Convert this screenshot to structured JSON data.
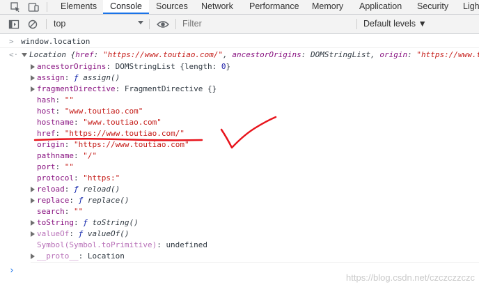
{
  "tabs": [
    {
      "label": "Elements",
      "active": false
    },
    {
      "label": "Console",
      "active": true
    },
    {
      "label": "Sources",
      "active": false
    },
    {
      "label": "Network",
      "active": false
    },
    {
      "label": "Performance",
      "active": false
    },
    {
      "label": "Memory",
      "active": false
    },
    {
      "label": "Application",
      "active": false
    },
    {
      "label": "Security",
      "active": false
    },
    {
      "label": "Ligh",
      "active": false
    }
  ],
  "toolbar": {
    "context": "top",
    "filter_placeholder": "Filter",
    "levels_label": "Default levels ▼"
  },
  "console": {
    "input_command": "window.location",
    "summary": {
      "type": "Location",
      "brace_open": " {",
      "href_key": "href",
      "href_val": "\"https://www.toutiao.com/\"",
      "ancestor_key": "ancestorOrigins",
      "ancestor_val": "DOMStringList",
      "origin_key": "origin",
      "origin_val": "\"https://www.t"
    },
    "props": {
      "ancestorOrigins": {
        "key": "ancestorOrigins",
        "type": "DOMStringList",
        "brace": "{length: ",
        "len": "0",
        "close": "}"
      },
      "assign": {
        "key": "assign",
        "fn": "ƒ",
        "name": "assign()"
      },
      "fragmentDirective": {
        "key": "fragmentDirective",
        "val": "FragmentDirective {}"
      },
      "hash": {
        "key": "hash",
        "val": "\"\""
      },
      "host": {
        "key": "host",
        "val": "\"www.toutiao.com\""
      },
      "hostname": {
        "key": "hostname",
        "val": "\"www.toutiao.com\""
      },
      "href": {
        "key": "href",
        "val": "\"https://www.toutiao.com/\""
      },
      "origin": {
        "key": "origin",
        "val": "\"https://www.toutiao.com\""
      },
      "pathname": {
        "key": "pathname",
        "val": "\"/\""
      },
      "port": {
        "key": "port",
        "val": "\"\""
      },
      "protocol": {
        "key": "protocol",
        "val": "\"https:\""
      },
      "reload": {
        "key": "reload",
        "fn": "ƒ",
        "name": "reload()"
      },
      "replace": {
        "key": "replace",
        "fn": "ƒ",
        "name": "replace()"
      },
      "search": {
        "key": "search",
        "val": "\"\""
      },
      "toString": {
        "key": "toString",
        "fn": "ƒ",
        "name": "toString()"
      },
      "valueOf": {
        "key": "valueOf",
        "fn": "ƒ",
        "name": "valueOf()"
      },
      "symbol": {
        "key": "Symbol(Symbol.toPrimitive)",
        "val": "undefined"
      },
      "proto": {
        "key": "__proto__",
        "val": "Location"
      }
    }
  },
  "annotation_color": "#e8141c",
  "accent_color": "#1a73e8",
  "watermark": "https://blog.csdn.net/czczczzczc"
}
